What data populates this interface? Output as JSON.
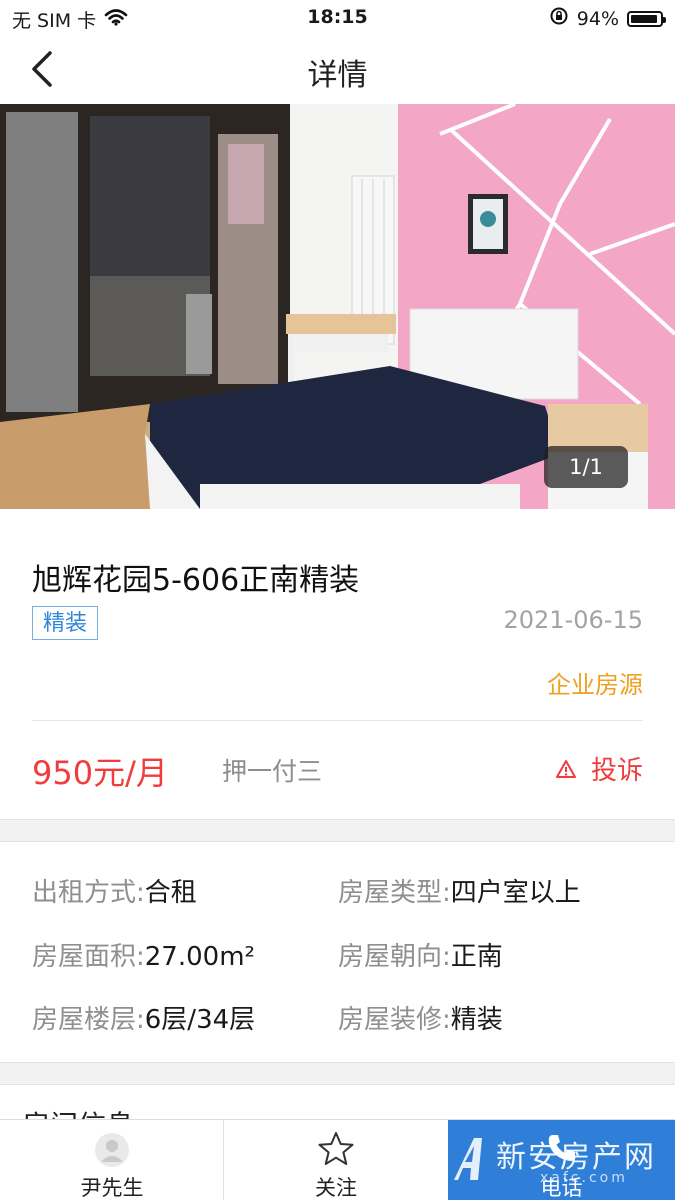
{
  "status_bar": {
    "carrier": "无 SIM 卡",
    "time": "18:15",
    "battery": "94%",
    "battery_level": 0.94
  },
  "nav": {
    "title": "详情"
  },
  "gallery": {
    "counter": "1/1"
  },
  "listing": {
    "title": "旭辉花园5-606正南精装",
    "tag": "精装",
    "date": "2021-06-15",
    "source": "企业房源",
    "price": "950元/月",
    "payment": "押一付三",
    "complain_label": "投诉"
  },
  "info": {
    "rows": [
      [
        {
          "key": "出租方式:",
          "value": "合租"
        },
        {
          "key": "房屋类型:",
          "value": "四户室以上"
        }
      ],
      [
        {
          "key": "房屋面积:",
          "value": "27.00m²"
        },
        {
          "key": "房屋朝向:",
          "value": "正南"
        }
      ],
      [
        {
          "key": "房屋楼层:",
          "value": "6层/34层"
        },
        {
          "key": "房屋装修:",
          "value": "精装"
        }
      ]
    ]
  },
  "next_section": {
    "heading": "房间信息"
  },
  "bottom_bar": {
    "contact_name": "尹先生",
    "follow_label": "关注",
    "call_label": "电话"
  },
  "watermark": {
    "text": "新安房产网",
    "sub": "xafc.com"
  },
  "colors": {
    "price": "#f23c3c",
    "accent": "#2f7fd8",
    "source": "#f0a020",
    "tag_border": "#79aee0"
  }
}
